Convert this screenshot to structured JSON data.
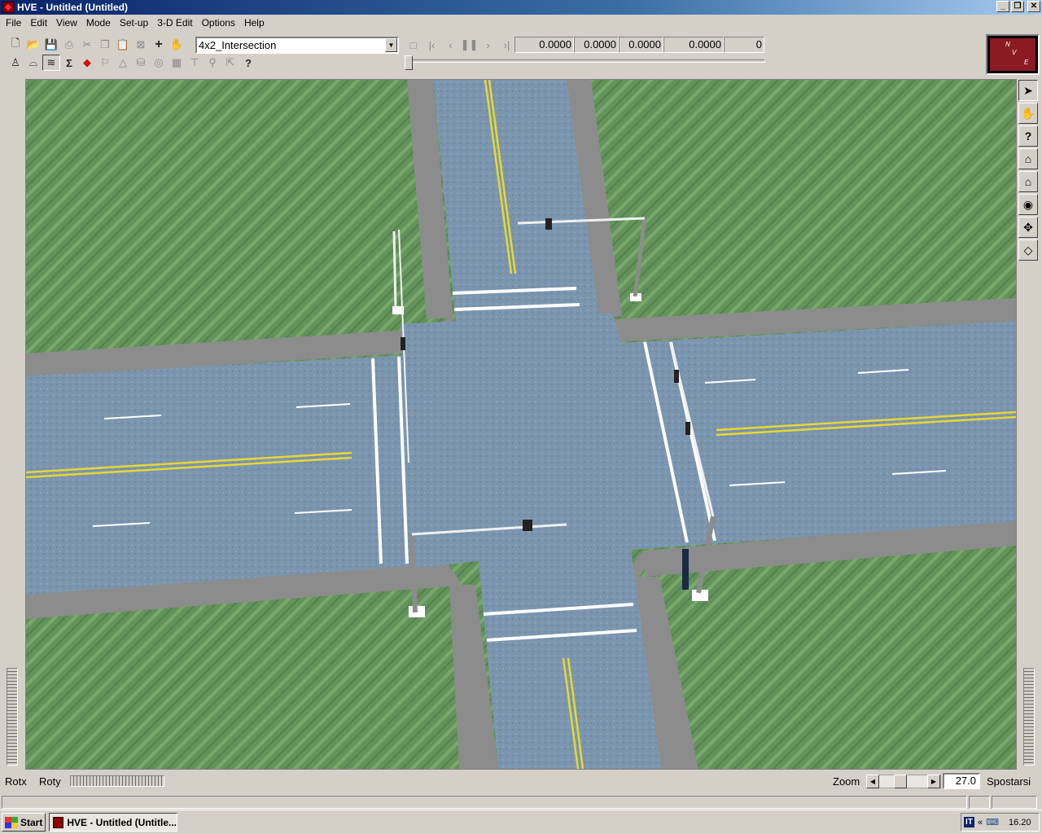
{
  "window": {
    "title": "HVE - Untitled (Untitled)",
    "controls": {
      "minimize": "_",
      "restore": "❐",
      "close": "✕"
    }
  },
  "menu": [
    "File",
    "Edit",
    "View",
    "Mode",
    "Set-up",
    "3-D Edit",
    "Options",
    "Help"
  ],
  "toolbar": {
    "row1_icons": [
      "new-file-icon",
      "open-folder-icon",
      "save-icon",
      "print-icon",
      "cut-icon",
      "copy-icon",
      "paste-icon",
      "delete-icon",
      "add-icon",
      "hand-icon"
    ],
    "row2_icons": [
      "event-icon",
      "vehicle-icon",
      "environment-icon",
      "sum-icon",
      "arrow-icon",
      "flag-icon",
      "triangle-icon",
      "database-icon",
      "target-icon",
      "grid-icon",
      "tee-icon",
      "pin-icon",
      "cursor-icon",
      "help-icon"
    ],
    "environment_select": "4x2_Intersection",
    "readouts": [
      "0.0000",
      "0.0000",
      "0.0000",
      "0.0000",
      "0"
    ],
    "playback_icons": [
      "stop-icon",
      "rewind-start-icon",
      "step-back-icon",
      "pause-icon",
      "step-forward-icon",
      "forward-end-icon"
    ]
  },
  "compass": {
    "n": "N",
    "v": "V",
    "e": "E"
  },
  "right_tools": [
    "select-arrow-icon",
    "pan-hand-icon",
    "query-help-icon",
    "home-icon",
    "home-edit-icon",
    "eye-icon",
    "move-icon",
    "perspective-icon"
  ],
  "bottom": {
    "rotx_label": "Rotx",
    "roty_label": "Roty",
    "zoom_label": "Zoom",
    "zoom_value": "27.0",
    "move_label": "Spostarsi"
  },
  "taskbar": {
    "start_label": "Start",
    "task_label": "HVE - Untitled (Untitle...",
    "lang": "IT",
    "tray_chevron": "«",
    "clock": "16.20"
  },
  "colors": {
    "grass": "#62935a",
    "road": "#7893ad",
    "curb": "#8c8c8c",
    "lane_marking": "#ffffff",
    "center_line": "#e6d832",
    "title_gradient_start": "#0a246a"
  }
}
